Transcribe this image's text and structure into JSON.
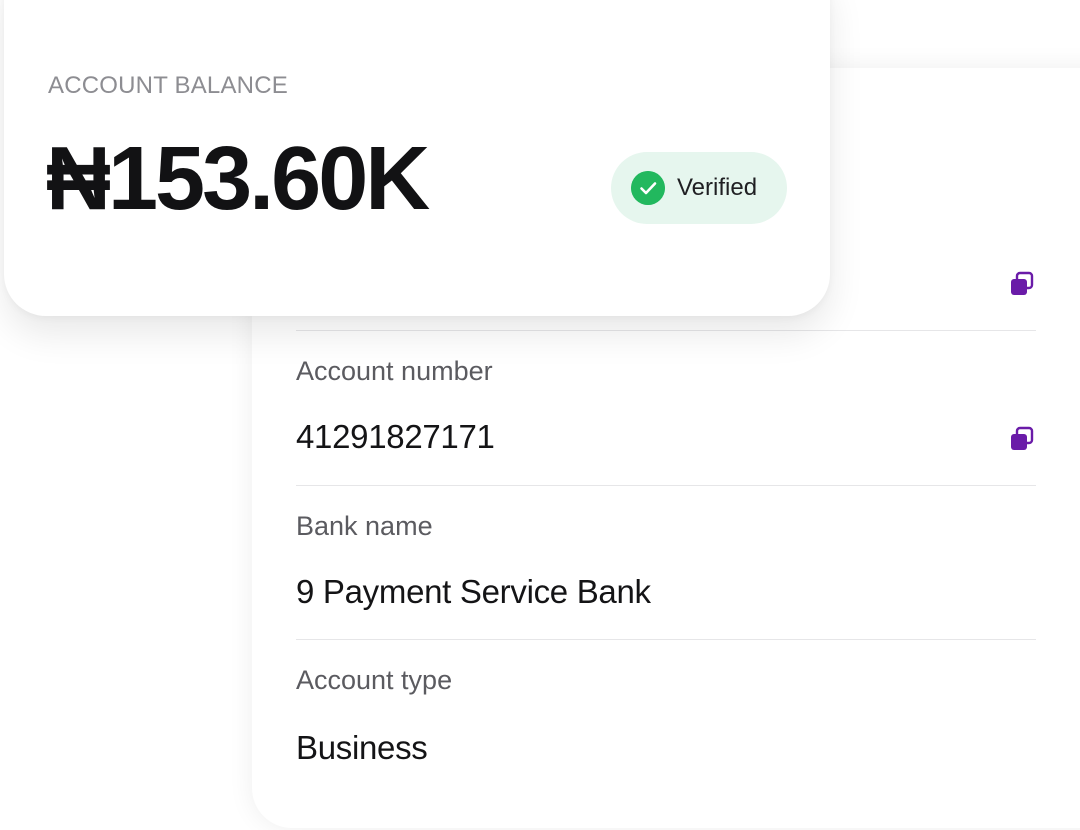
{
  "balance": {
    "label": "ACCOUNT BALANCE",
    "amount": "₦153.60K",
    "status": "Verified"
  },
  "details": [
    {
      "label": "Account number",
      "value": "41291827171"
    },
    {
      "label": "Bank name",
      "value": "9 Payment Service Bank"
    },
    {
      "label": "Account type",
      "value": "Business"
    }
  ],
  "icons": {
    "copy": "copy-icon",
    "verified": "check-circle-icon"
  },
  "colors": {
    "accent": "#6a1ba8",
    "verified_bg": "#e6f6ee",
    "verified_icon": "#22b85e"
  }
}
